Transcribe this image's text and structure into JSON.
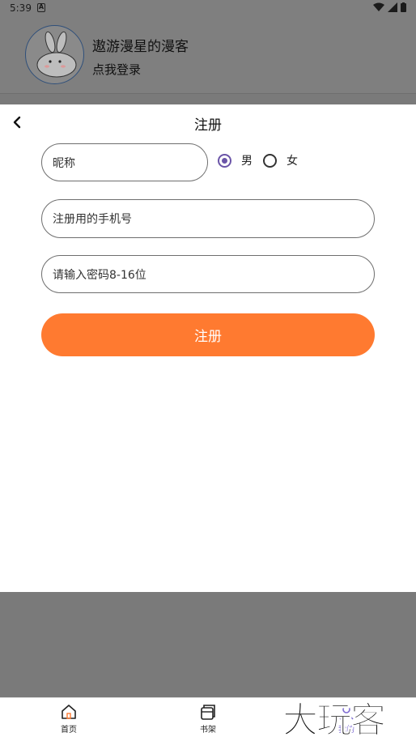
{
  "status_bar": {
    "time": "5:39",
    "notification_icon": "a-icon",
    "system_icons": [
      "wifi-icon",
      "signal-icon",
      "battery-icon"
    ]
  },
  "profile": {
    "nickname": "遨游漫星的漫客",
    "login_prompt": "点我登录",
    "avatar_icon": "bunny-avatar"
  },
  "register": {
    "title": "注册",
    "nickname_placeholder": "昵称",
    "gender": {
      "male_label": "男",
      "female_label": "女",
      "selected": "男"
    },
    "phone_placeholder": "注册用的手机号",
    "password_placeholder": "请输入密码8-16位",
    "submit_label": "注册"
  },
  "bottom_nav": {
    "items": [
      {
        "label": "首页",
        "icon": "home-icon"
      },
      {
        "label": "书架",
        "icon": "bookshelf-icon"
      },
      {
        "label": "我的",
        "icon": "profile-icon"
      }
    ]
  },
  "watermark": {
    "text": "大玩客"
  },
  "colors": {
    "accent": "#ff7a30",
    "radio": "#6b55a8",
    "overlay": "#7a7a7a",
    "nav_active": "#7d6ad1"
  }
}
